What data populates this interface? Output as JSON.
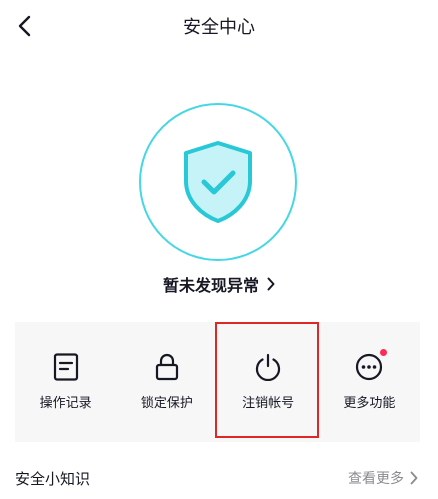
{
  "header": {
    "title": "安全中心",
    "back_icon": "chevron-left-icon"
  },
  "status": {
    "icon": "shield-check-icon",
    "text": "暂未发现异常",
    "ring_color": "#45d7e4"
  },
  "functions": [
    {
      "label": "操作记录",
      "icon": "document-icon"
    },
    {
      "label": "锁定保护",
      "icon": "lock-icon"
    },
    {
      "label": "注销帐号",
      "icon": "power-icon"
    },
    {
      "label": "更多功能",
      "icon": "more-dots-icon",
      "badge": true
    }
  ],
  "highlight_color": "#e02727",
  "knowledge": {
    "title": "安全小知识",
    "more_label": "查看更多"
  }
}
